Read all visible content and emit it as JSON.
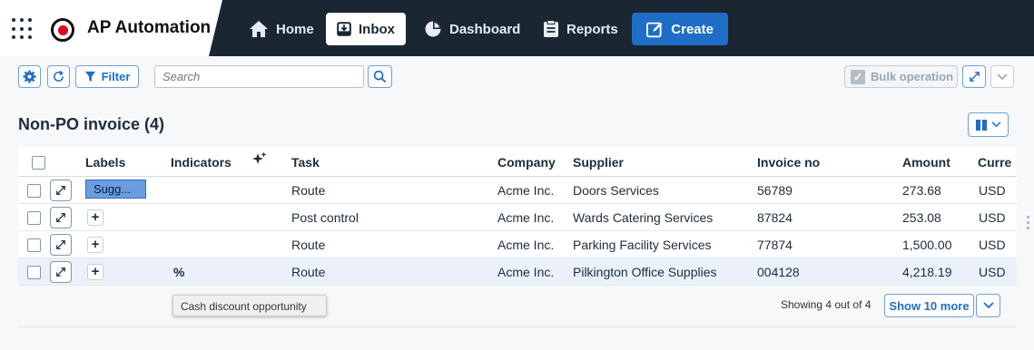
{
  "app": {
    "title": "AP Automation"
  },
  "nav": {
    "home": "Home",
    "inbox": "Inbox",
    "dashboard": "Dashboard",
    "reports": "Reports",
    "create": "Create"
  },
  "toolbar": {
    "filter": "Filter",
    "search_placeholder": "Search",
    "bulk": "Bulk operation"
  },
  "section": {
    "title": "Non-PO invoice (4)"
  },
  "table": {
    "columns": [
      "Labels",
      "Indicators",
      "Task",
      "Company",
      "Supplier",
      "Invoice no",
      "Amount",
      "Curre"
    ],
    "rows": [
      {
        "label": "Sugg...",
        "indicator": "",
        "task": "Route",
        "company": "Acme Inc.",
        "supplier": "Doors Services",
        "invoice": "56789",
        "amount": "273.68",
        "currency": "USD"
      },
      {
        "label": "",
        "indicator": "",
        "task": "Post control",
        "company": "Acme Inc.",
        "supplier": "Wards Catering Services",
        "invoice": "87824",
        "amount": "253.08",
        "currency": "USD"
      },
      {
        "label": "",
        "indicator": "",
        "task": "Route",
        "company": "Acme Inc.",
        "supplier": "Parking Facility Services",
        "invoice": "77874",
        "amount": "1,500.00",
        "currency": "USD"
      },
      {
        "label": "",
        "indicator": "%",
        "task": "Route",
        "company": "Acme Inc.",
        "supplier": "Pilkington Office Supplies",
        "invoice": "004128",
        "amount": "4,218.19",
        "currency": "USD"
      }
    ]
  },
  "tooltip": "Cash discount opportunity",
  "footer": {
    "showing": "Showing 4 out of 4",
    "more": "Show 10 more"
  },
  "colors": {
    "topbar": "#1a2733",
    "accent": "#1e6ec8",
    "selected_row": "#eaf1fa"
  }
}
